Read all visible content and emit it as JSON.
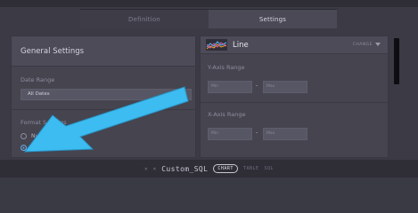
{
  "tabs": [
    {
      "label": "Definition"
    },
    {
      "label": "Settings"
    }
  ],
  "general": {
    "title": "General Settings",
    "date_range_label": "Date Range",
    "date_range_value": "All Dates",
    "format_label": "Format Settings",
    "options": [
      {
        "label": "Number",
        "checked": false
      },
      {
        "label": "Dollar",
        "checked": true
      }
    ]
  },
  "chart_settings": {
    "chart_type": "Line",
    "change_label": "CHANGE",
    "y_axis_label": "Y-Axis Range",
    "x_axis_label": "X-Axis Range",
    "min_placeholder": "Min",
    "max_placeholder": "Max",
    "range_separator": "-"
  },
  "bottom_bar": {
    "close_glyph": "×",
    "pin_glyph": "×",
    "title": "Custom_SQL",
    "tabs": [
      {
        "label": "CHART",
        "active": true
      },
      {
        "label": "TABLE",
        "active": false
      },
      {
        "label": "SQL",
        "active": false
      }
    ]
  },
  "colors": {
    "arrow": "#3cbcf0",
    "radio_checked": "#6ea8e0"
  }
}
